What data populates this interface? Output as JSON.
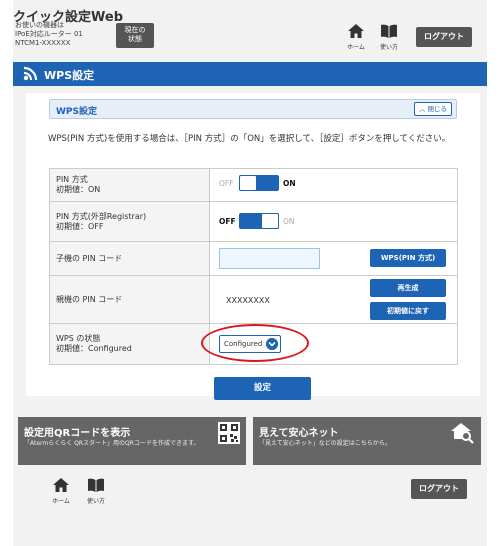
{
  "header": {
    "app_title": "クイック設定Web",
    "device_info": "お使いの機器は\nIPoE対応ルーター 01\nNTCM1-XXXXXX",
    "status_button": "現在の\n状態",
    "home_label": "ホーム",
    "help_label": "使い方",
    "logout_label": "ログアウト"
  },
  "section": {
    "title": "WPS設定"
  },
  "panel": {
    "title": "WPS設定",
    "collapse_label": "閉じる",
    "description": "WPS(PIN 方式)を使用する場合は、［PIN 方式］の「ON」を選択して、［設定］ボタンを押してください。"
  },
  "rows": {
    "pin": {
      "label": "PIN 方式",
      "default": "初期値：ON",
      "off": "OFF",
      "on": "ON",
      "state": "on"
    },
    "pin_ext": {
      "label": "PIN 方式(外部Registrar)",
      "default": "初期値：OFF",
      "off": "OFF",
      "on": "ON",
      "state": "off"
    },
    "child_pin": {
      "label": "子機の PIN コード",
      "value": "",
      "button": "WPS(PIN 方式)"
    },
    "parent_pin": {
      "label": "親機の PIN コード",
      "value": "XXXXXXXX",
      "regen_button": "再生成",
      "reset_button": "初期値に戻す"
    },
    "wps_status": {
      "label": "WPS の状態",
      "default": "初期値：Configured",
      "selected": "Configured"
    }
  },
  "apply_button": "設定",
  "cards": {
    "qr": {
      "title": "設定用QRコードを表示",
      "subtitle": "「Atermらくらく QRスタート」用のQRコードを作成できます。"
    },
    "safe": {
      "title": "見えて安心ネット",
      "subtitle": "「見えて安心ネット」などの設定はこちらから。"
    }
  },
  "footer": {
    "home_label": "ホーム",
    "help_label": "使い方",
    "logout_label": "ログアウト"
  },
  "colors": {
    "primary": "#1e64b4",
    "header_bar": "#1e64b4",
    "highlight_ring": "#e0151b",
    "card_bg": "#666666"
  }
}
